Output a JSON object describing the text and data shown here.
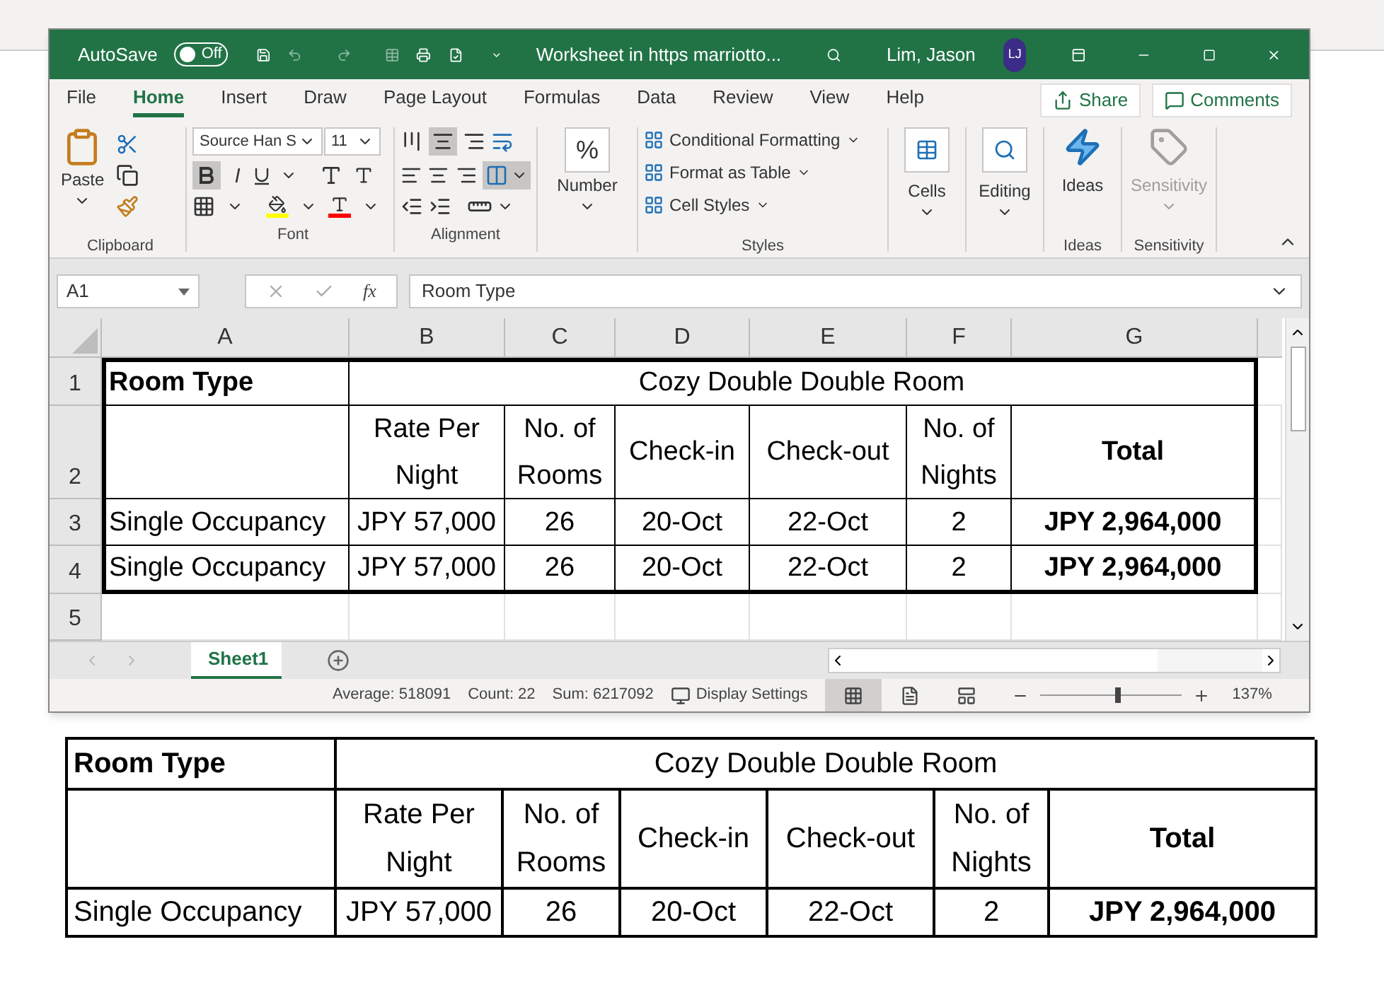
{
  "window": {
    "title_bar": {
      "autosave_label": "AutoSave",
      "autosave_toggle": {
        "label": "Off",
        "on": false
      },
      "title": "Worksheet in https  marriotto...",
      "user": "Lim, Jason",
      "avatar_initials": "LJ"
    },
    "menu_tabs": [
      {
        "label": "File",
        "selected": false
      },
      {
        "label": "Home",
        "selected": true
      },
      {
        "label": "Insert",
        "selected": false
      },
      {
        "label": "Draw",
        "selected": false
      },
      {
        "label": "Page Layout",
        "selected": false
      },
      {
        "label": "Formulas",
        "selected": false
      },
      {
        "label": "Data",
        "selected": false
      },
      {
        "label": "Review",
        "selected": false
      },
      {
        "label": "View",
        "selected": false
      },
      {
        "label": "Help",
        "selected": false
      }
    ],
    "share_button": "Share",
    "comments_button": "Comments",
    "ribbon": {
      "clipboard": {
        "paste": "Paste",
        "label": "Clipboard"
      },
      "font": {
        "font_name": "Source Han S",
        "font_size": "11",
        "bold_selected": true,
        "label": "Font"
      },
      "alignment": {
        "middle_align_selected": true,
        "merge_selected": true,
        "label": "Alignment"
      },
      "number": {
        "symbol": "%",
        "button": "Number"
      },
      "styles": {
        "items": [
          "Conditional Formatting",
          "Format as Table",
          "Cell Styles"
        ],
        "label": "Styles"
      },
      "cells": {
        "button": "Cells"
      },
      "editing": {
        "button": "Editing"
      },
      "ideas": {
        "button": "Ideas",
        "label": "Ideas"
      },
      "sensitivity": {
        "button": "Sensitivity",
        "disabled": true,
        "label": "Sensitivity"
      }
    },
    "formula_bar": {
      "name_box": "A1",
      "function_label": "fx",
      "content": "Room Type"
    },
    "sheet": {
      "columns": [
        "A",
        "B",
        "C",
        "D",
        "E",
        "F",
        "G"
      ],
      "title_row": {
        "number": "1",
        "label": "Room Type",
        "title": "Cozy Double Double Room"
      },
      "rows": [
        {
          "number": "2",
          "cells": [
            {},
            {
              "text": "Rate Per Night",
              "bold": false
            },
            {
              "text": "No. of Rooms",
              "bold": false
            },
            {
              "text": "Check-in",
              "bold": false
            },
            {
              "text": "Check-out",
              "bold": false
            },
            {
              "text": "No. of Nights",
              "bold": false
            },
            {
              "text": "Total",
              "bold": true
            }
          ]
        },
        {
          "number": "3",
          "cells": [
            {
              "text": "Single Occupancy",
              "bold": false
            },
            {
              "text": "JPY 57,000",
              "bold": false
            },
            {
              "text": "26",
              "bold": false
            },
            {
              "text": "20-Oct",
              "bold": false
            },
            {
              "text": "22-Oct",
              "bold": false
            },
            {
              "text": "2",
              "bold": false
            },
            {
              "text": "JPY 2,964,000",
              "bold": true
            }
          ]
        },
        {
          "number": "4",
          "cells": [
            {
              "text": "Single Occupancy",
              "bold": false
            },
            {
              "text": "JPY 57,000",
              "bold": false
            },
            {
              "text": "26",
              "bold": false
            },
            {
              "text": "20-Oct",
              "bold": false
            },
            {
              "text": "22-Oct",
              "bold": false
            },
            {
              "text": "2",
              "bold": false
            },
            {
              "text": "JPY 2,964,000",
              "bold": true
            }
          ]
        },
        {
          "number": "5",
          "cells": []
        }
      ]
    },
    "sheet_tabs": [
      {
        "label": "Sheet1",
        "selected": true
      }
    ],
    "status_bar": {
      "average": "Average: 518091",
      "count": "Count: 22",
      "sum": "Sum: 6217092",
      "display_settings": "Display Settings",
      "views": [
        {
          "kind": "normal",
          "selected": true
        },
        {
          "kind": "page_layout",
          "selected": false
        },
        {
          "kind": "page_break",
          "selected": false
        }
      ],
      "zoom": {
        "level": 0.55,
        "reading": "137%"
      }
    }
  },
  "pasted_table": {
    "title_row": {
      "label": "Room Type",
      "title": "Cozy Double Double Room"
    },
    "rows": [
      [
        {},
        {
          "text": "Rate Per Night",
          "bold": false
        },
        {
          "text": "No. of Rooms",
          "bold": false
        },
        {
          "text": "Check-in",
          "bold": false
        },
        {
          "text": "Check-out",
          "bold": false
        },
        {
          "text": "No. of Nights",
          "bold": false
        },
        {
          "text": "Total",
          "bold": true
        }
      ],
      [
        {
          "text": "Single Occupancy",
          "bold": false
        },
        {
          "text": "JPY 57,000",
          "bold": false
        },
        {
          "text": "26",
          "bold": false
        },
        {
          "text": "20-Oct",
          "bold": false
        },
        {
          "text": "22-Oct",
          "bold": false
        },
        {
          "text": "2",
          "bold": false
        },
        {
          "text": "JPY 2,964,000",
          "bold": true
        }
      ]
    ]
  }
}
